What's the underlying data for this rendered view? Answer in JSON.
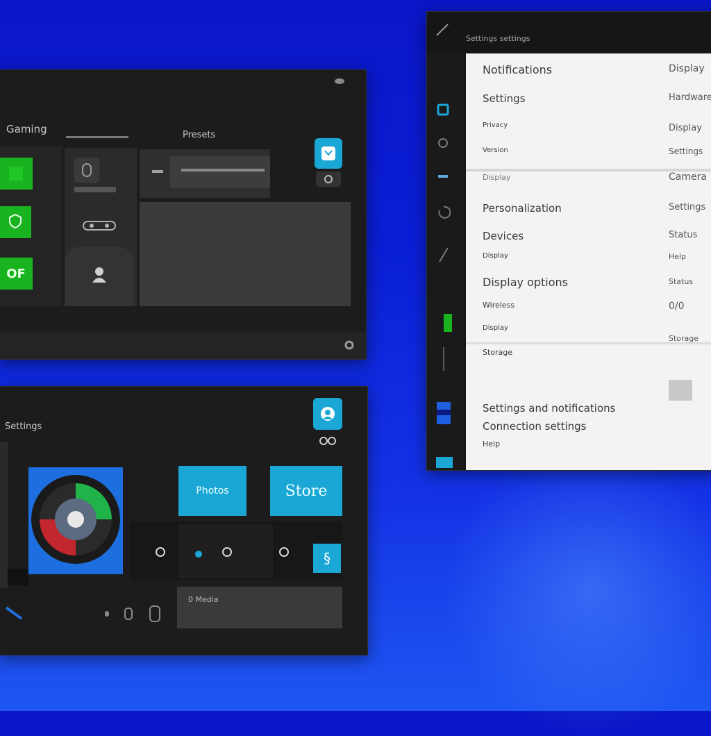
{
  "colors": {
    "accent_cyan": "#1aa7d6",
    "accent_green": "#19b31f",
    "window_bg": "#1c1c1c",
    "desktop_blue": "#0a1fd6"
  },
  "window1": {
    "title": "Gaming",
    "tiles": [
      "",
      "",
      "OF"
    ],
    "section_title": "Presets",
    "media_label": "Settings",
    "avatar_icon": "user-icon"
  },
  "window2": {
    "title": "Settings",
    "tiles": [
      "Photos",
      "Store"
    ],
    "search_value": "0 Media",
    "media_icon": "disc-icon"
  },
  "window3": {
    "header_title": "Settings settings",
    "sections": [
      {
        "label": "Notifications",
        "value": "Display"
      },
      {
        "label": "Settings",
        "value": "Hardware"
      },
      {
        "label": "Privacy",
        "value": "Display"
      },
      {
        "label": "Version",
        "value": "Settings"
      },
      {
        "label": "Display",
        "value": "Camera"
      },
      {
        "label": "Personalization",
        "value": "Settings"
      },
      {
        "label": "Devices",
        "value": "Status"
      },
      {
        "label": "Display",
        "value": "Help"
      },
      {
        "label": "Display options",
        "value": "Status"
      },
      {
        "label": "Wireless",
        "value": "0/0"
      },
      {
        "label": "Display",
        "value": "Storage"
      },
      {
        "label": "Storage",
        "value": ""
      },
      {
        "label": "Settings and notifications",
        "value": ""
      },
      {
        "label": "Connection settings",
        "value": ""
      },
      {
        "label": "Help",
        "value": ""
      }
    ]
  }
}
